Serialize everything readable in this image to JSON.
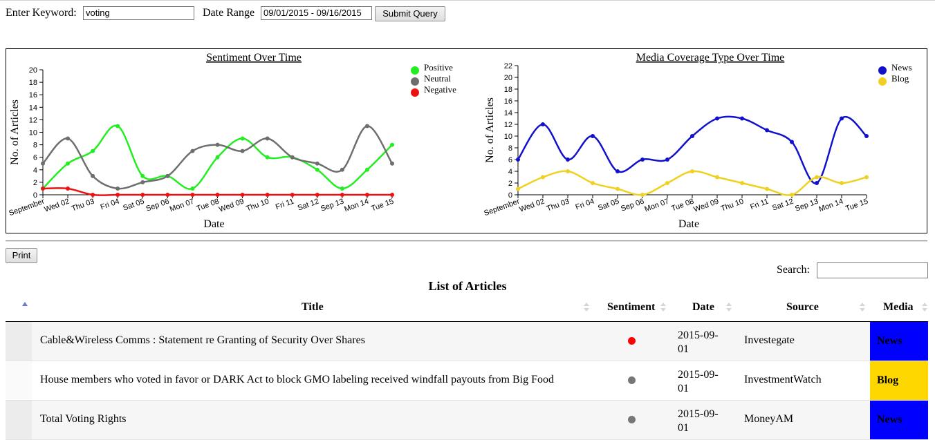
{
  "form": {
    "keyword_label": "Enter Keyword:",
    "keyword_value": "voting",
    "date_range_label": "Date Range",
    "date_range_value": "09/01/2015 - 09/16/2015",
    "submit_label": "Submit Query"
  },
  "print_label": "Print",
  "search_label": "Search:",
  "list_title": "List of Articles",
  "table": {
    "headers": [
      "Title",
      "Sentiment",
      "Date",
      "Source",
      "Media"
    ],
    "rows": [
      {
        "title": "Cable&Wireless Comms : Statement re Granting of Security Over Shares",
        "sentiment": "Negative",
        "sentiment_color": "#ff0000",
        "date_line1": "2015-09-",
        "date_line2": "01",
        "source": "Investegate",
        "media": "News",
        "media_bg": "#0000ff",
        "media_fg": "#000000"
      },
      {
        "title": "House members who voted in favor or DARK Act to block GMO labeling received windfall payouts from Big Food",
        "sentiment": "Neutral",
        "sentiment_color": "#777777",
        "date_line1": "2015-09-",
        "date_line2": "01",
        "source": "InvestmentWatch",
        "media": "Blog",
        "media_bg": "#ffd700",
        "media_fg": "#000000"
      },
      {
        "title": "Total Voting Rights",
        "sentiment": "Neutral",
        "sentiment_color": "#777777",
        "date_line1": "2015-09-",
        "date_line2": "01",
        "source": "MoneyAM",
        "media": "News",
        "media_bg": "#0000ff",
        "media_fg": "#000000"
      }
    ]
  },
  "chart_data": [
    {
      "type": "line",
      "title": "Sentiment Over Time",
      "xlabel": "Date",
      "ylabel": "No. of Articles",
      "categories": [
        "September",
        "Wed 02",
        "Thu 03",
        "Fri 04",
        "Sat 05",
        "Sep 06",
        "Mon 07",
        "Tue 08",
        "Wed 09",
        "Thu 10",
        "Fri 11",
        "Sat 12",
        "Sep 13",
        "Mon 14",
        "Tue 15"
      ],
      "ylim": [
        0,
        20
      ],
      "yticks": [
        0,
        2,
        4,
        6,
        8,
        10,
        12,
        14,
        16,
        18,
        20
      ],
      "legend_position": "top-right",
      "series": [
        {
          "name": "Positive",
          "color": "#22ee22",
          "values": [
            1,
            5,
            7,
            11,
            3,
            3,
            1,
            6,
            9,
            6,
            6,
            4,
            1,
            4,
            8
          ]
        },
        {
          "name": "Neutral",
          "color": "#6e6e6e",
          "values": [
            5,
            9,
            3,
            1,
            2,
            3,
            7,
            8,
            7,
            9,
            6,
            5,
            4,
            11,
            5
          ]
        },
        {
          "name": "Negative",
          "color": "#ee1111",
          "values": [
            1,
            1,
            0,
            0,
            0,
            0,
            0,
            0,
            0,
            0,
            0,
            0,
            0,
            0,
            0
          ]
        }
      ]
    },
    {
      "type": "line",
      "title": "Media Coverage Type Over Time",
      "xlabel": "Date",
      "ylabel": "No. of Articles",
      "categories": [
        "September",
        "Wed 02",
        "Thu 03",
        "Fri 04",
        "Sat 05",
        "Sep 06",
        "Mon 07",
        "Tue 08",
        "Wed 09",
        "Thu 10",
        "Fri 11",
        "Sat 12",
        "Sep 13",
        "Mon 14",
        "Tue 15"
      ],
      "ylim": [
        0,
        22
      ],
      "yticks": [
        0,
        2,
        4,
        6,
        8,
        10,
        12,
        14,
        16,
        18,
        20,
        22
      ],
      "legend_position": "top-right",
      "series": [
        {
          "name": "News",
          "color": "#1111cc",
          "values": [
            6,
            12,
            6,
            10,
            4,
            6,
            6,
            10,
            13,
            13,
            11,
            9,
            2,
            13,
            10
          ]
        },
        {
          "name": "Blog",
          "color": "#f0d020",
          "values": [
            1,
            3,
            4,
            2,
            1,
            0,
            2,
            4,
            3,
            2,
            1,
            0,
            3,
            2,
            3
          ]
        }
      ]
    }
  ]
}
